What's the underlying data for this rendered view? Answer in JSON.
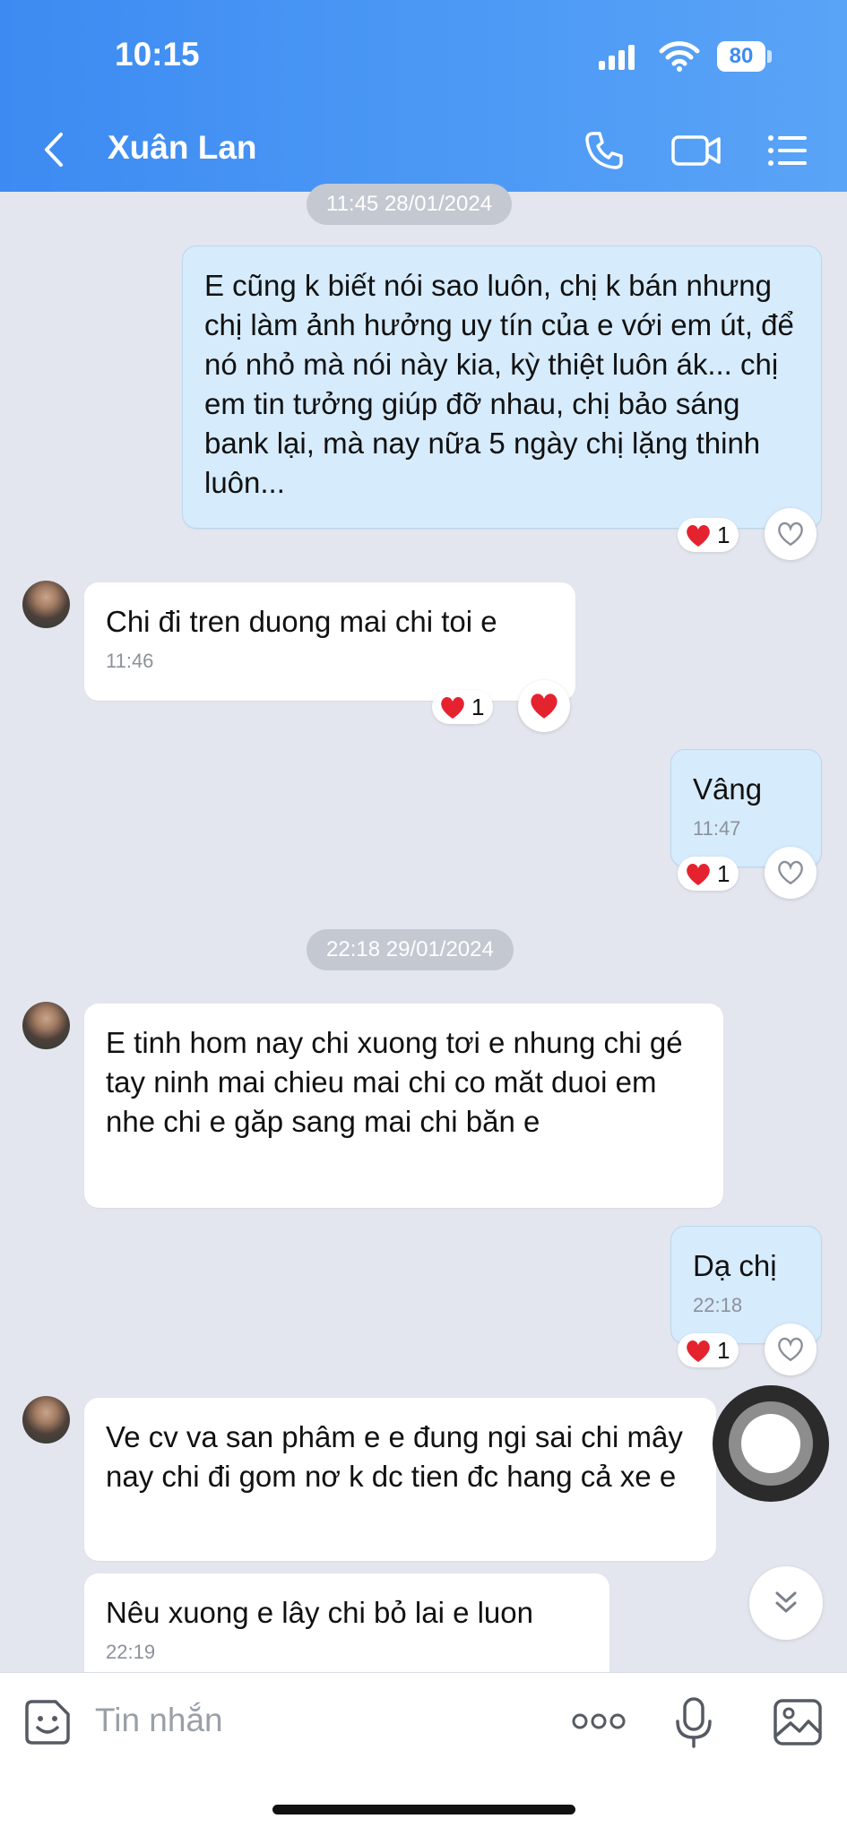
{
  "status_bar": {
    "time": "10:15",
    "battery": "80"
  },
  "header": {
    "contact_name": "Xuân Lan"
  },
  "messages": {
    "date1": "11:45 28/01/2024",
    "m1": {
      "text": "E cũng k biết nói sao luôn, chị k bán nhưng chị làm ảnh hưởng uy tín của e với em út, để nó nhỏ mà nói này kia, kỳ thiệt luôn ák... chị em tin tưởng giúp đỡ nhau, chị bảo sáng bank lại, mà nay nữa 5 ngày chị lặng thinh luôn...",
      "reaction_count": "1"
    },
    "m2": {
      "text": "Chi đi tren duong mai chi toi e",
      "time": "11:46",
      "reaction_count": "1"
    },
    "m3": {
      "text": "Vâng",
      "time": "11:47",
      "reaction_count": "1"
    },
    "date2": "22:18 29/01/2024",
    "m4": {
      "text": "E  tinh hom nay chi xuong tơi e nhung chi gé tay ninh mai chieu mai chi co măt duoi em nhe chi e găp  sang mai chi băn e"
    },
    "m5": {
      "text": "Dạ chị",
      "time": "22:18",
      "reaction_count": "1"
    },
    "m6": {
      "text": "Ve cv va san phâm e e đung ngi sai chi mây nay chi đi gom nơ k dc tien đc hang cả xe e"
    },
    "m7": {
      "text": "Nêu xuong e lây chi bỏ lai e luon",
      "time": "22:19"
    }
  },
  "composer": {
    "placeholder": "Tin nhắn"
  },
  "colors": {
    "header": "#4d9af5",
    "outgoing_bubble": "#d6ebfc",
    "incoming_bubble": "#ffffff",
    "heart": "#e5232f"
  },
  "icons": [
    "back-chevron-icon",
    "phone-icon",
    "video-call-icon",
    "menu-list-icon",
    "heart-icon",
    "sticker-icon",
    "more-options-icon",
    "microphone-icon",
    "image-icon",
    "scroll-down-icon"
  ]
}
